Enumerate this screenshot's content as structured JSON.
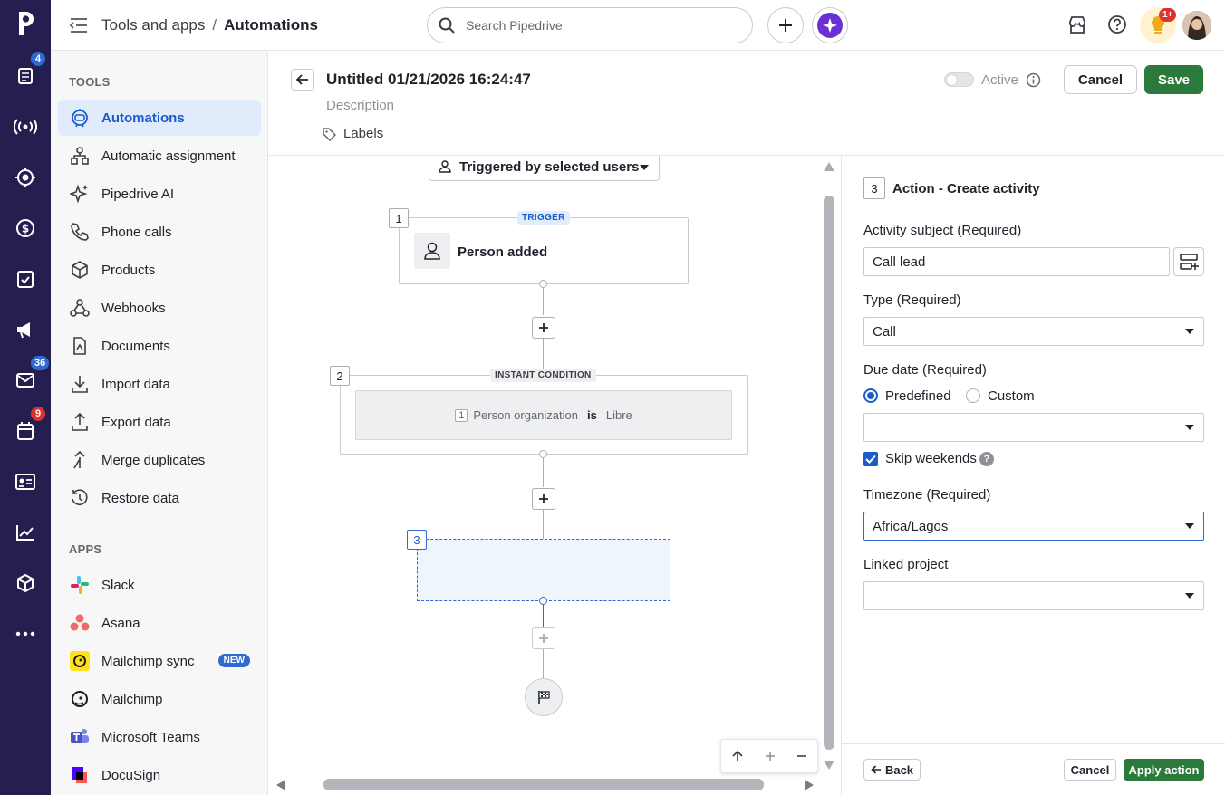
{
  "rail": {
    "badges": {
      "leads": "4",
      "mail": "36",
      "activities": "9"
    }
  },
  "topbar": {
    "breadcrumb_parent": "Tools and apps",
    "breadcrumb_sep": "/",
    "breadcrumb_current": "Automations",
    "search_placeholder": "Search Pipedrive",
    "notif_badge": "1+"
  },
  "sidebar": {
    "tools_heading": "TOOLS",
    "tools": [
      {
        "label": "Automations"
      },
      {
        "label": "Automatic assignment"
      },
      {
        "label": "Pipedrive AI"
      },
      {
        "label": "Phone calls"
      },
      {
        "label": "Products"
      },
      {
        "label": "Webhooks"
      },
      {
        "label": "Documents"
      },
      {
        "label": "Import data"
      },
      {
        "label": "Export data"
      },
      {
        "label": "Merge duplicates"
      },
      {
        "label": "Restore data"
      }
    ],
    "apps_heading": "APPS",
    "apps": [
      {
        "label": "Slack"
      },
      {
        "label": "Asana"
      },
      {
        "label": "Mailchimp sync",
        "badge": "NEW"
      },
      {
        "label": "Mailchimp"
      },
      {
        "label": "Microsoft Teams"
      },
      {
        "label": "DocuSign"
      }
    ]
  },
  "header": {
    "title": "Untitled 01/21/2026 16:24:47",
    "description_placeholder": "Description",
    "labels": "Labels",
    "active_label": "Active",
    "cancel": "Cancel",
    "save": "Save"
  },
  "canvas": {
    "trigger_dropdown": "Triggered by selected users",
    "step1": {
      "num": "1",
      "tag": "TRIGGER",
      "label": "Person added"
    },
    "step2": {
      "num": "2",
      "tag": "INSTANT CONDITION",
      "cond_num": "1",
      "cond_field": "Person organization",
      "cond_op": "is",
      "cond_value": "Libre"
    },
    "step3": {
      "num": "3"
    }
  },
  "panel": {
    "step_num": "3",
    "title": "Action - Create activity",
    "subject_label": "Activity subject (Required)",
    "subject_value": "Call lead",
    "type_label": "Type (Required)",
    "type_value": "Call",
    "due_label": "Due date (Required)",
    "due_opt1": "Predefined",
    "due_opt2": "Custom",
    "due_value": "",
    "skip_weekends": "Skip weekends",
    "timezone_label": "Timezone (Required)",
    "timezone_value": "Africa/Lagos",
    "project_label": "Linked project",
    "project_value": "",
    "back": "Back",
    "cancel": "Cancel",
    "apply": "Apply action"
  },
  "colors": {
    "brand": "#241f4f",
    "accent": "#2e6ad1",
    "save": "#2c7a3b"
  }
}
